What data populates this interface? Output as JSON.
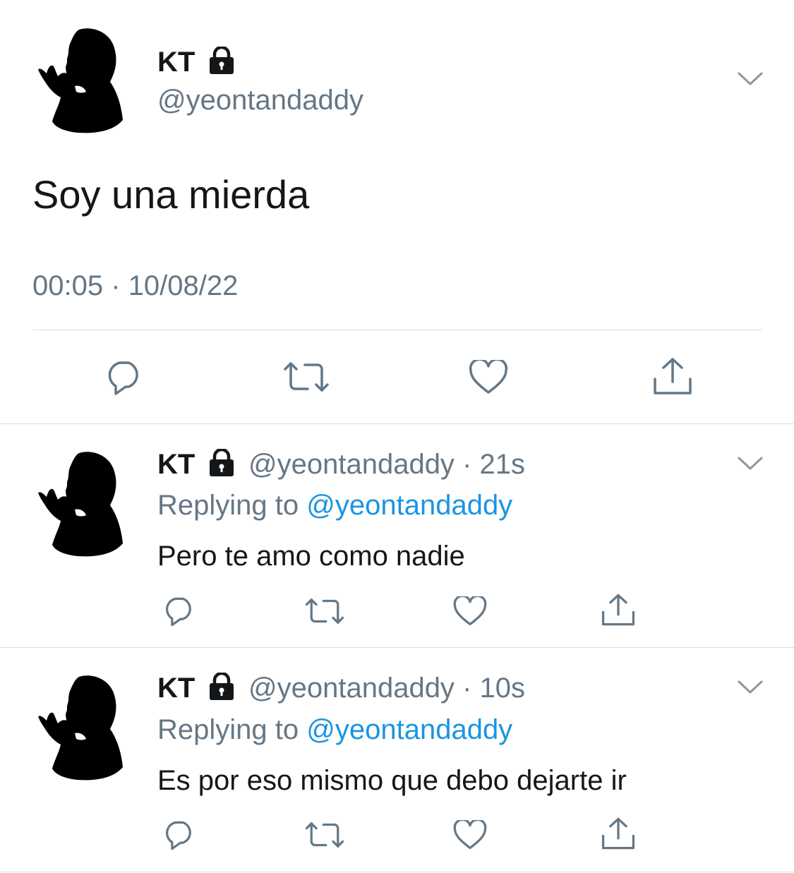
{
  "main_tweet": {
    "display_name": "KT",
    "handle": "@yeontandaddy",
    "text": "Soy una mierda",
    "time": "00:05",
    "date": "10/08/22",
    "separator": "·"
  },
  "replies": [
    {
      "display_name": "KT",
      "handle": "@yeontandaddy",
      "age": "21s",
      "replying_prefix": "Replying to",
      "replying_to": "@yeontandaddy",
      "text": "Pero te amo como nadie"
    },
    {
      "display_name": "KT",
      "handle": "@yeontandaddy",
      "age": "10s",
      "replying_prefix": "Replying to",
      "replying_to": "@yeontandaddy",
      "text": "Es por eso mismo que debo dejarte ir"
    }
  ],
  "icons": {
    "lock": "lock-icon",
    "reply": "reply-icon",
    "retweet": "retweet-icon",
    "like": "heart-icon",
    "share": "share-icon",
    "menu": "chevron-down-icon"
  },
  "colors": {
    "text": "#14171a",
    "secondary": "#657786",
    "link": "#1b95e0",
    "divider": "#dcdcdc"
  }
}
